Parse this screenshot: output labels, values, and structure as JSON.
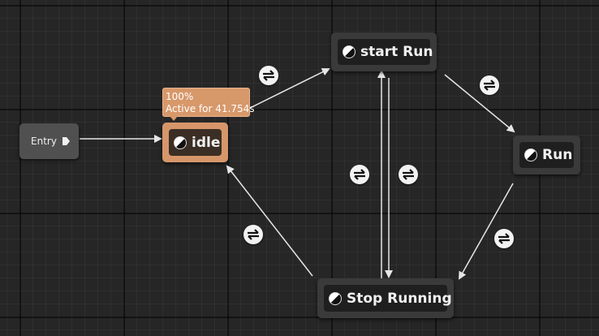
{
  "entry": {
    "label": "Entry"
  },
  "tooltip": {
    "weight": "100%",
    "active_text": "Active for 41.754s"
  },
  "states": {
    "idle": "idle",
    "start_run": "start Run",
    "run": "Run",
    "stop_running": "Stop Running"
  },
  "icons": {
    "state": "state-half-circle-icon",
    "transition": "transition-arrows-icon",
    "entry_pin": "exec-pin-icon"
  },
  "colors": {
    "active_state": "#d6966a",
    "node_bg": "#3a3a3a",
    "wire": "#e6e6e6",
    "graph_bg": "#262626"
  }
}
